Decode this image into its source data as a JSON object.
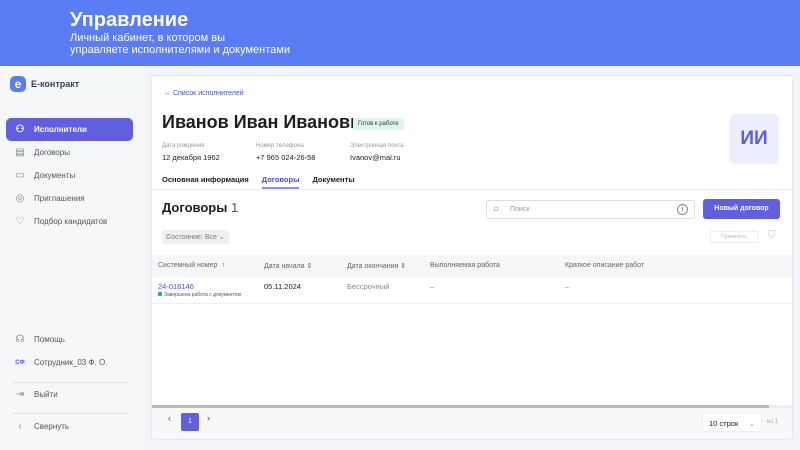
{
  "banner": {
    "title": "Управление",
    "subtitle_line1": "Личный кабинет, в котором вы",
    "subtitle_line2": "управляете исполнителями и документами"
  },
  "brand": {
    "name": "E-контракт",
    "accent": "#5f5fe0"
  },
  "sidebar": {
    "items": [
      {
        "label": "Исполнители",
        "icon": "users-icon",
        "active": true
      },
      {
        "label": "Договоры",
        "icon": "document-icon"
      },
      {
        "label": "Документы",
        "icon": "folder-icon"
      },
      {
        "label": "Приглашения",
        "icon": "invite-icon"
      },
      {
        "label": "Подбор кандидатов",
        "icon": "handshake-icon"
      }
    ],
    "help": "Помощь",
    "user_initials": "СФ",
    "user": "Сотрудник_03 Ф. О.",
    "logout": "Выйти",
    "collapse": "Свернуть"
  },
  "profile": {
    "back": "Список исполнителей",
    "name": "Иванов Иван Иванович",
    "status": "Готов к работе",
    "initials": "ИИ",
    "birth_label": "Дата рождения",
    "birth": "12 декабря 1962",
    "phone_label": "Номер телефона",
    "phone": "+7 965 024-26-58",
    "email_label": "Электронная почта",
    "email": "Ivanov@mal.ru",
    "tabs": [
      "Основная информация",
      "Договоры",
      "Документы"
    ],
    "active_tab": "Договоры"
  },
  "contracts": {
    "title": "Договоры",
    "count": "1",
    "search_placeholder": "Поиск",
    "new_button": "Новый договор",
    "state_filter": "Состояние: Все",
    "apply": "Применить",
    "columns": [
      "Системный номер",
      "Дата начала",
      "Дата окончания",
      "Выполняемая работа",
      "Краткое описание работ"
    ],
    "rows": [
      {
        "number": "24-016146",
        "status": "Завершена работа с документом",
        "start": "05.11.2024",
        "end": "Бессрочный",
        "work": "–",
        "desc": "–"
      }
    ]
  },
  "pagination": {
    "page": "1",
    "rows": "10 строк",
    "of": "из 1"
  }
}
